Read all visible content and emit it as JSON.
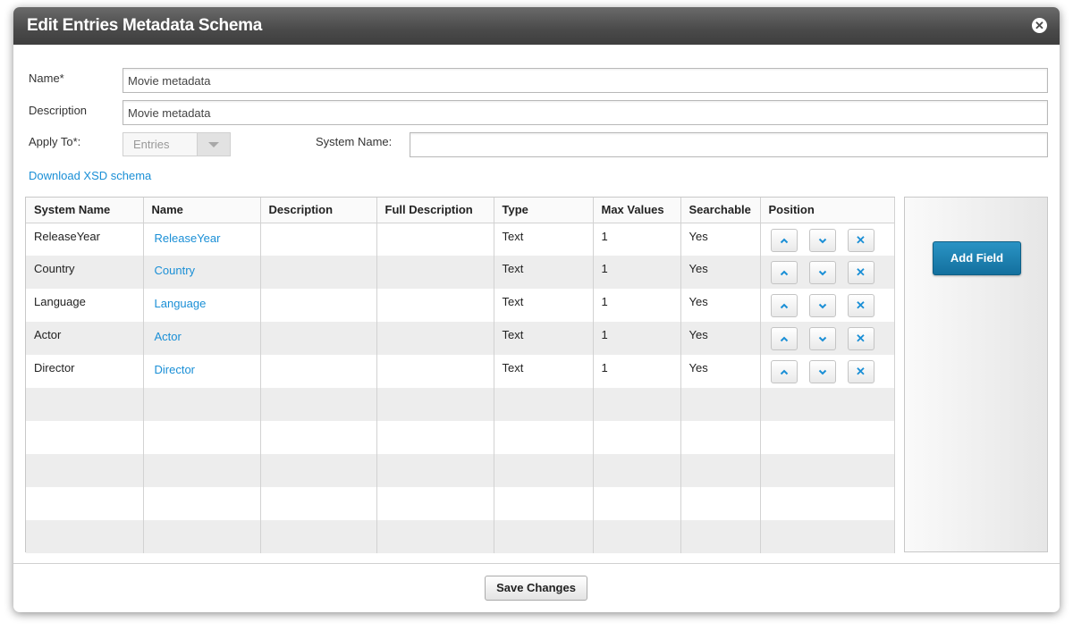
{
  "dialog": {
    "title": "Edit Entries Metadata Schema",
    "close_icon": "close-icon"
  },
  "form": {
    "name_label": "Name*",
    "name_value": "Movie metadata",
    "description_label": "Description",
    "description_value": "Movie metadata",
    "apply_to_label": "Apply To*:",
    "apply_to_value": "Entries",
    "system_name_label": "System Name:",
    "system_name_value": "",
    "download_link": "Download XSD schema"
  },
  "table": {
    "columns": [
      "System Name",
      "Name",
      "Description",
      "Full Description",
      "Type",
      "Max Values",
      "Searchable",
      "Position"
    ],
    "rows": [
      {
        "system_name": "ReleaseYear",
        "name": "ReleaseYear",
        "description": "",
        "full_description": "",
        "type": "Text",
        "max_values": "1",
        "searchable": "Yes"
      },
      {
        "system_name": "Country",
        "name": "Country",
        "description": "",
        "full_description": "",
        "type": "Text",
        "max_values": "1",
        "searchable": "Yes"
      },
      {
        "system_name": "Language",
        "name": "Language",
        "description": "",
        "full_description": "",
        "type": "Text",
        "max_values": "1",
        "searchable": "Yes"
      },
      {
        "system_name": "Actor",
        "name": "Actor",
        "description": "",
        "full_description": "",
        "type": "Text",
        "max_values": "1",
        "searchable": "Yes"
      },
      {
        "system_name": "Director",
        "name": "Director",
        "description": "",
        "full_description": "",
        "type": "Text",
        "max_values": "1",
        "searchable": "Yes"
      }
    ],
    "position_icons": [
      "chevron-up-icon",
      "chevron-down-icon",
      "delete-icon"
    ]
  },
  "side_panel": {
    "add_field_label": "Add Field"
  },
  "footer": {
    "save_label": "Save Changes"
  },
  "colors": {
    "link": "#1a8fd6",
    "primary_button": "#1b7fb0",
    "title_bar": "#4a4a4a"
  }
}
